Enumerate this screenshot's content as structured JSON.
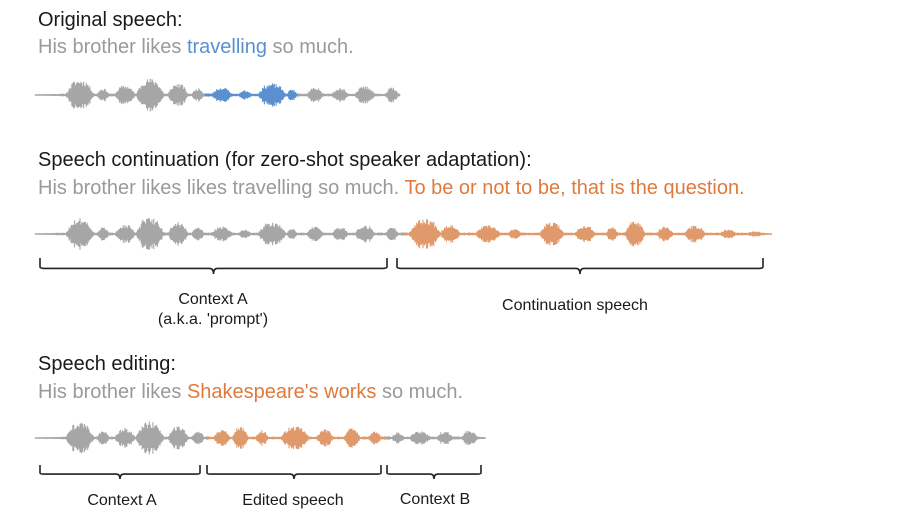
{
  "colors": {
    "gray_wave": "#a6a6a6",
    "blue": "#5b8fcf",
    "orange": "#e0996a",
    "orange_text": "#e07a3c",
    "bracket": "#222222"
  },
  "original": {
    "heading": "Original speech:",
    "sentence_pre": "His brother likes ",
    "sentence_highlight": "travelling",
    "sentence_post": " so much."
  },
  "continuation": {
    "heading": "Speech continuation (for zero-shot speaker adaptation):",
    "sentence_pre": "His brother likes likes travelling so much. ",
    "sentence_highlight": "To be or not to be, that is the question.",
    "context_label_line1": "Context A",
    "context_label_line2": "(a.k.a. 'prompt')",
    "continuation_label": "Continuation speech"
  },
  "editing": {
    "heading": "Speech editing:",
    "sentence_pre": "His brother likes ",
    "sentence_highlight": "Shakespeare's works",
    "sentence_post": " so much.",
    "context_a_label": "Context A",
    "edited_label": "Edited speech",
    "context_b_label": "Context B"
  }
}
